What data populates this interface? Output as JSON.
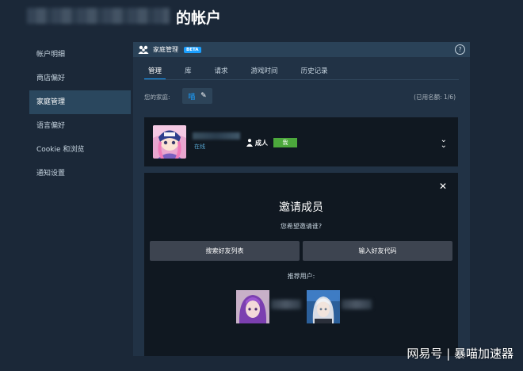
{
  "header": {
    "title_suffix": "的帐户"
  },
  "sidebar": {
    "items": [
      {
        "label": "帐户明细"
      },
      {
        "label": "商店偏好"
      },
      {
        "label": "家庭管理"
      },
      {
        "label": "语言偏好"
      },
      {
        "label": "Cookie 和浏览"
      },
      {
        "label": "通知设置"
      }
    ],
    "active_index": 2
  },
  "panel": {
    "title": "家庭管理",
    "badge": "BETA",
    "help_icon": "?",
    "tabs": [
      "管理",
      "库",
      "请求",
      "游戏时间",
      "历史记录"
    ],
    "active_tab": 0,
    "family_label": "您的家庭:",
    "family_name": "喵",
    "usage_text": "(已用名额: 1/6)"
  },
  "member": {
    "status": "在线",
    "role": "成人",
    "me_badge": "我"
  },
  "invite": {
    "title": "邀请成员",
    "subtitle": "您希望邀请谁?",
    "btn_search_friends": "搜索好友列表",
    "btn_friend_code": "输入好友代码",
    "recommended_label": "推荐用户:"
  },
  "watermark": "网易号 | 暴喵加速器",
  "colors": {
    "accent": "#1a9fff",
    "me_badge": "#4ca83c",
    "background": "#1b2838"
  }
}
